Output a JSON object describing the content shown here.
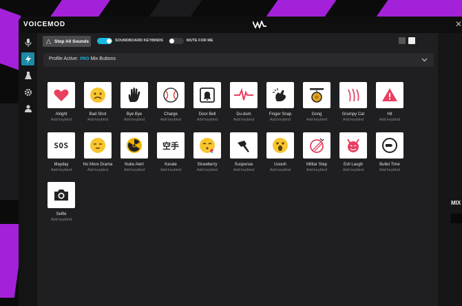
{
  "app": {
    "title": "VOICEMOD"
  },
  "toolbar": {
    "stop_all": "Stop All Sounds",
    "keybinds_toggle": {
      "label": "SOUNDBOARD KEYBINDS",
      "state": "on"
    },
    "mute_toggle": {
      "label": "MUTE FOR ME",
      "state": "off"
    }
  },
  "profile": {
    "prefix": "Profile Active:",
    "badge": "PRO",
    "name": "Mix Buttons"
  },
  "right_panel": {
    "label": "MIX"
  },
  "colors": {
    "accent": "#17b9e3",
    "brand_purple": "#a321d8"
  },
  "sounds": [
    {
      "name": "Alright",
      "keybind": "Add keybind",
      "icon": "heart-icon"
    },
    {
      "name": "Bad Shot",
      "keybind": "Add keybind",
      "icon": "confused-face-icon"
    },
    {
      "name": "Bye Bye",
      "keybind": "Add keybind",
      "icon": "waving-hand-icon"
    },
    {
      "name": "Charge",
      "keybind": "Add keybind",
      "icon": "baseball-icon"
    },
    {
      "name": "Door Bell",
      "keybind": "Add keybind",
      "icon": "bell-icon"
    },
    {
      "name": "Du-dum",
      "keybind": "Add keybind",
      "icon": "heartbeat-icon"
    },
    {
      "name": "Finger Snap",
      "keybind": "Add keybind",
      "icon": "snap-hand-icon"
    },
    {
      "name": "Gong",
      "keybind": "Add keybind",
      "icon": "gong-icon"
    },
    {
      "name": "Grumpy Cat",
      "keybind": "Add keybind",
      "icon": "claw-marks-icon"
    },
    {
      "name": "Hit",
      "keybind": "Add keybind",
      "icon": "warning-icon"
    },
    {
      "name": "Mayday",
      "keybind": "Add keybind",
      "icon": "sos-icon",
      "text": "SOS"
    },
    {
      "name": "No More Drama",
      "keybind": "Add keybind",
      "icon": "sleepy-face-icon"
    },
    {
      "name": "Nuke Alert",
      "keybind": "Add keybind",
      "icon": "radiation-icon"
    },
    {
      "name": "Karate",
      "keybind": "Add keybind",
      "icon": "karate-kanji-icon",
      "text": "空手"
    },
    {
      "name": "Strawberry",
      "keybind": "Add keybind",
      "icon": "kissing-face-icon"
    },
    {
      "name": "Suspense",
      "keybind": "Add keybind",
      "icon": "knife-icon"
    },
    {
      "name": "Uoooh",
      "keybind": "Add keybind",
      "icon": "surprised-face-icon"
    },
    {
      "name": "Militar Step",
      "keybind": "Add keybind",
      "icon": "target-icon"
    },
    {
      "name": "Evil Laugh",
      "keybind": "Add keybind",
      "icon": "devil-icon"
    },
    {
      "name": "Bullet Time",
      "keybind": "Add keybind",
      "icon": "bullet-icon"
    },
    {
      "name": "Selfie",
      "keybind": "Add keybind",
      "icon": "camera-icon"
    }
  ]
}
